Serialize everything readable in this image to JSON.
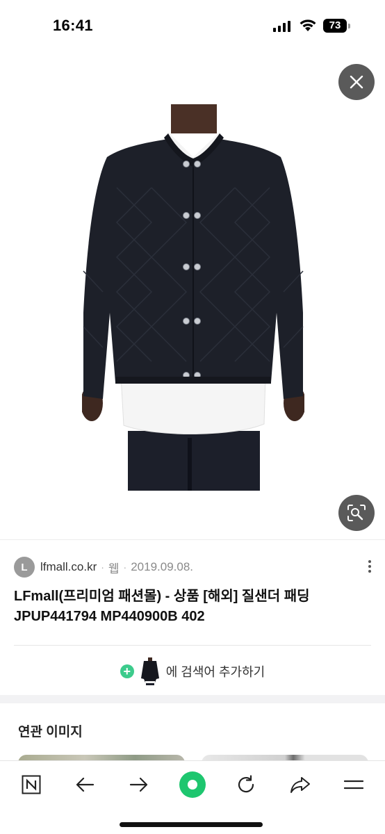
{
  "status_bar": {
    "time": "16:41",
    "battery": "73"
  },
  "viewer": {
    "close_icon": "close-icon",
    "lens_icon": "image-search-icon"
  },
  "source": {
    "avatar_letter": "L",
    "domain": "lfmall.co.kr",
    "separator": "·",
    "type": "웹",
    "date": "2019.09.08."
  },
  "result": {
    "title": "LFmall(프리미엄 패션몰) - 상품 [해외] 질샌더 패딩 JPUP441794 MP440900B 402"
  },
  "add_search": {
    "plus": "+",
    "label": "에 검색어 추가하기"
  },
  "related": {
    "title": "연관 이미지"
  },
  "bottom_nav": {
    "icons": [
      "naver-n-icon",
      "back-arrow-icon",
      "forward-arrow-icon",
      "green-dot-icon",
      "refresh-icon",
      "share-icon",
      "menu-icon"
    ],
    "accent": "#1ec66f"
  }
}
